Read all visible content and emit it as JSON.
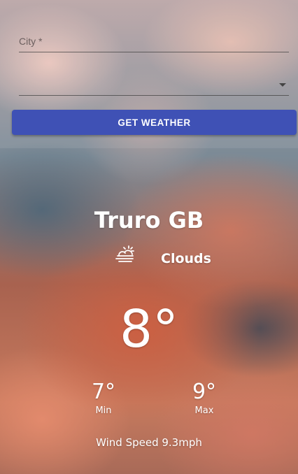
{
  "form": {
    "city_label": "City *",
    "country_value": "",
    "button_label": "GET WEATHER"
  },
  "weather": {
    "location": "Truro GB",
    "condition_icon": "partly-cloudy-icon",
    "condition": "Clouds",
    "temp": "8°",
    "min_value": "7°",
    "min_label": "Min",
    "max_value": "9°",
    "max_label": "Max",
    "wind": "Wind Speed 9.3mph"
  },
  "colors": {
    "button": "#3f51b5",
    "text": "#ffffff"
  }
}
